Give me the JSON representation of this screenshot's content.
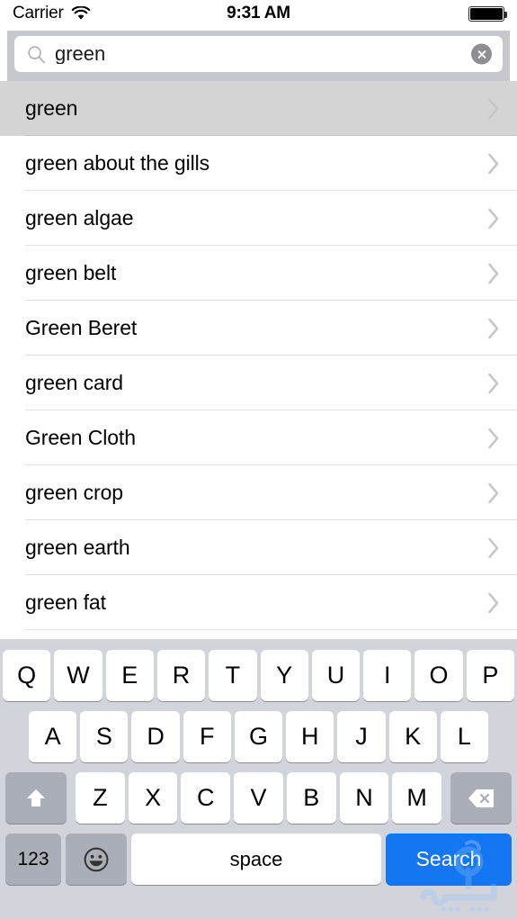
{
  "status_bar": {
    "carrier": "Carrier",
    "wifi_icon": "wifi-icon",
    "time": "9:31 AM",
    "battery_icon": "battery-full-icon"
  },
  "search": {
    "icon": "search-magnifier-icon",
    "value": "green",
    "placeholder": "Search",
    "clear_icon": "clear-circle-x-icon"
  },
  "results": {
    "selected_index": 0,
    "accessory_icon": "chevron-right-icon",
    "items": [
      {
        "label": "green"
      },
      {
        "label": "green about the gills"
      },
      {
        "label": "green algae"
      },
      {
        "label": "green belt"
      },
      {
        "label": "Green Beret"
      },
      {
        "label": "green card"
      },
      {
        "label": "Green Cloth"
      },
      {
        "label": "green crop"
      },
      {
        "label": "green earth"
      },
      {
        "label": "green fat"
      }
    ]
  },
  "keyboard": {
    "row1": [
      "Q",
      "W",
      "E",
      "R",
      "T",
      "Y",
      "U",
      "I",
      "O",
      "P"
    ],
    "row2": [
      "A",
      "S",
      "D",
      "F",
      "G",
      "H",
      "J",
      "K",
      "L"
    ],
    "row3": [
      "Z",
      "X",
      "C",
      "V",
      "B",
      "N",
      "M"
    ],
    "shift_icon": "shift-up-arrow-icon",
    "backspace_icon": "backspace-delete-icon",
    "numeric_label": "123",
    "emoji_icon": "emoji-smiley-icon",
    "space_label": "space",
    "search_label": "Search"
  },
  "colors": {
    "search_bar_bg": "#c6c8cd",
    "keyboard_bg": "#d1d4da",
    "key_bg": "#ffffff",
    "key_dark_bg": "#a9aeb7",
    "search_key_blue": "#1476f2",
    "row_selected_bg": "#d4d4d4",
    "separator": "#e2e2e2"
  },
  "watermark": {
    "name": "arabic-logo-watermark"
  }
}
